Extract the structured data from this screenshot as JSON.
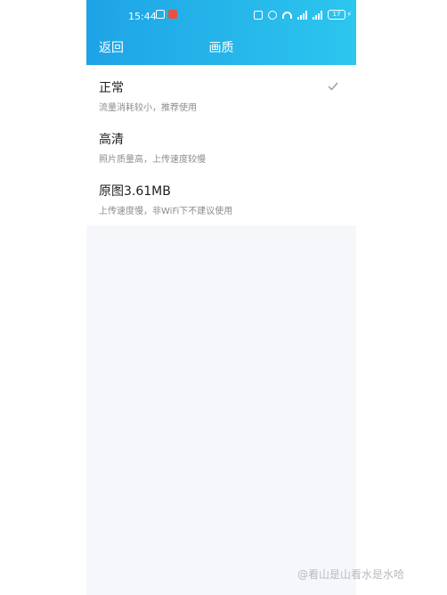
{
  "status_bar": {
    "time": "15:44",
    "battery": "17"
  },
  "header": {
    "back_label": "返回",
    "title": "画质"
  },
  "options": [
    {
      "title": "正常",
      "desc": "流量消耗较小，推荐使用",
      "selected": true
    },
    {
      "title": "高清",
      "desc": "照片质量高，上传速度较慢",
      "selected": false
    },
    {
      "title": "原图3.61MB",
      "desc": "上传速度慢，非WiFi下不建议使用",
      "selected": false
    }
  ],
  "watermark": "@看山是山看水是水哈",
  "colors": {
    "header_start": "#1ea3e6",
    "header_end": "#2cc6ee",
    "check": "#9a9a9a"
  }
}
